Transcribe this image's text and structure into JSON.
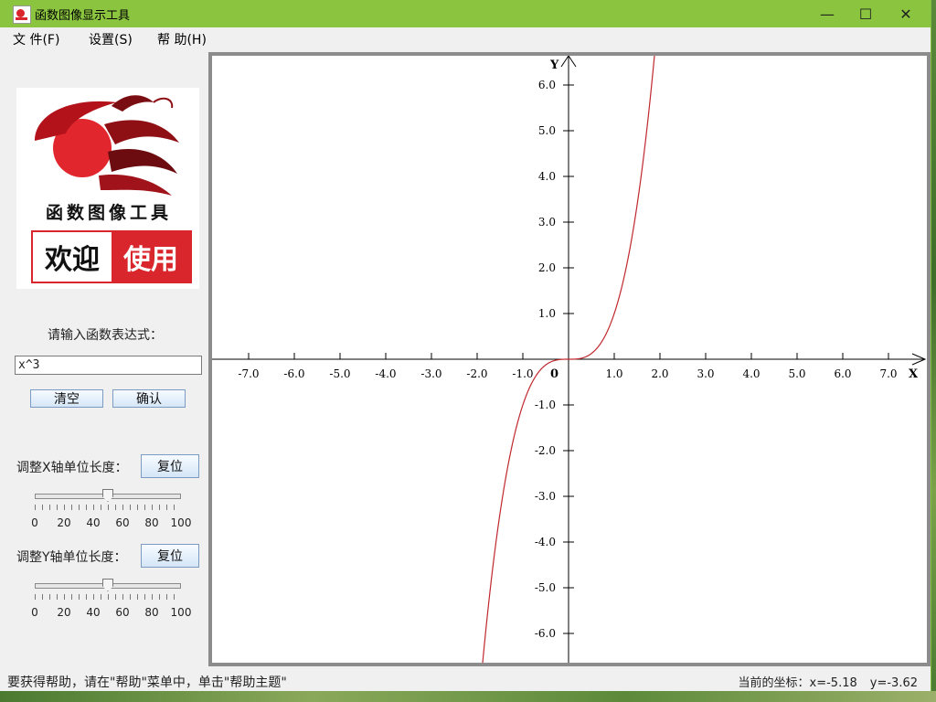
{
  "window": {
    "title": "函数图像显示工具",
    "controls": {
      "minimize": "—",
      "maximize": "☐",
      "close": "✕"
    }
  },
  "menubar": {
    "items": [
      {
        "label": "文 件(F)"
      },
      {
        "label": "设置(S)"
      },
      {
        "label": "帮 助(H)"
      }
    ]
  },
  "logo": {
    "title": "函数图像工具",
    "welcome_left": "欢迎",
    "welcome_right": "使用"
  },
  "panel": {
    "expression_label": "请输入函数表达式：",
    "expression_value": "x^3",
    "clear_label": "清空",
    "confirm_label": "确认",
    "x_unit_label": "调整X轴单位长度：",
    "y_unit_label": "调整Y轴单位长度：",
    "reset_label": "复位",
    "x_slider_value": 50,
    "y_slider_value": 50,
    "slider_ticks": [
      "0",
      "20",
      "40",
      "60",
      "80",
      "100"
    ]
  },
  "graph": {
    "x_axis_label": "X",
    "y_axis_label": "Y",
    "origin_label": "0",
    "function": "x^3",
    "x_range": [
      -7.0,
      7.0
    ],
    "y_range": [
      -6.0,
      6.0
    ],
    "x_ticks": [
      "-7.0",
      "-6.0",
      "-5.0",
      "-4.0",
      "-3.0",
      "-2.0",
      "-1.0",
      "1.0",
      "2.0",
      "3.0",
      "4.0",
      "5.0",
      "6.0",
      "7.0"
    ],
    "y_ticks": [
      "6.0",
      "5.0",
      "4.0",
      "3.0",
      "2.0",
      "1.0",
      "-1.0",
      "-2.0",
      "-3.0",
      "-4.0",
      "-5.0",
      "-6.0"
    ],
    "curve_color": "#c0282e"
  },
  "status": {
    "help_text": "要获得帮助，请在\"帮助\"菜单中，单击\"帮助主题\"",
    "coord_label": "当前的坐标：",
    "x_coord": "x=-5.18",
    "y_coord": "y=-3.62"
  }
}
